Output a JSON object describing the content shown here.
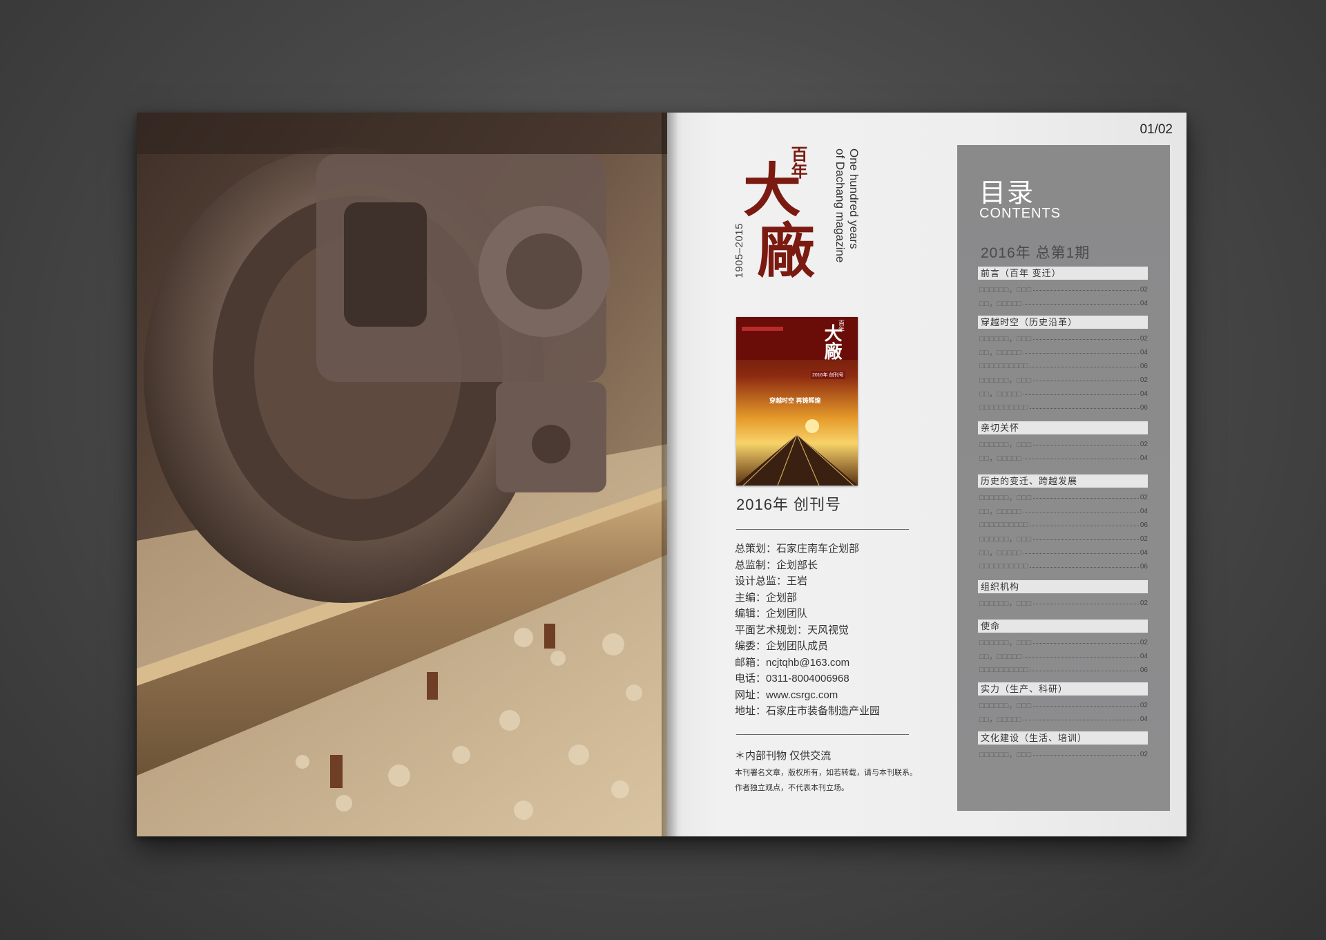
{
  "colors": {
    "logo_red": "#7a1a10",
    "panel_gray": "#8c8c8d",
    "section_bar": "#e6e6e6"
  },
  "page_number": "01/02",
  "masthead": {
    "logo_small": "百年",
    "logo_large_1": "大",
    "logo_large_2": "廠",
    "english_line1": "One hundred years",
    "english_line2": "of Dachang magazine",
    "years": "1905–2015"
  },
  "cover": {
    "logo_small": "百年",
    "logo_large": "大廠",
    "edition_tag": "2016年 创刊号",
    "headline": "穿越时空  再铸辉煌"
  },
  "edition": "2016年 创刊号",
  "credits": [
    {
      "label": "总策划",
      "value": "石家庄南车企划部"
    },
    {
      "label": "总监制",
      "value": "企划部长"
    },
    {
      "label": "设计总监",
      "value": "王岩"
    },
    {
      "label": "主编",
      "value": "企划部"
    },
    {
      "label": "编辑",
      "value": "企划团队"
    },
    {
      "label": "平面艺术规划",
      "value": "天风视觉"
    },
    {
      "label": "编委",
      "value": "企划团队成员"
    },
    {
      "label": "邮箱",
      "value": "ncjtqhb@163.com"
    },
    {
      "label": "电话",
      "value": "0311-8004006968"
    },
    {
      "label": "网址",
      "value": "www.csrgc.com"
    },
    {
      "label": "地址",
      "value": "石家庄市装备制造产业园"
    }
  ],
  "notice": {
    "line1": "＊内部刊物  仅供交流",
    "line2": "本刊署名文章，版权所有，如若转载，请与本刊联系。",
    "line3": "作者独立观点，不代表本刊立场。"
  },
  "contents": {
    "title": "目录",
    "subtitle": "CONTENTS",
    "issue": "2016年 总第1期",
    "sections": [
      {
        "heading": "前言（百年 变迁）",
        "entries": [
          {
            "text": "□□□□□□，□□□",
            "page": "02"
          },
          {
            "text": "□□，□□□□□",
            "page": "04"
          }
        ]
      },
      {
        "heading": "穿越时空（历史沿革）",
        "entries": [
          {
            "text": "□□□□□□，□□□",
            "page": "02"
          },
          {
            "text": "□□，□□□□□",
            "page": "04"
          },
          {
            "text": "□□□□□□□□□□",
            "page": "06"
          },
          {
            "text": "□□□□□□，□□□",
            "page": "02"
          },
          {
            "text": "□□，□□□□□",
            "page": "04"
          },
          {
            "text": "□□□□□□□□□□",
            "page": "06"
          }
        ]
      },
      {
        "heading": "亲切关怀",
        "entries": [
          {
            "text": "□□□□□□，□□□",
            "page": "02"
          },
          {
            "text": "□□，□□□□□",
            "page": "04"
          }
        ]
      },
      {
        "heading": "历史的变迁、跨越发展",
        "entries": [
          {
            "text": "□□□□□□，□□□",
            "page": "02"
          },
          {
            "text": "□□，□□□□□",
            "page": "04"
          },
          {
            "text": "□□□□□□□□□□",
            "page": "06"
          },
          {
            "text": "□□□□□□，□□□",
            "page": "02"
          },
          {
            "text": "□□，□□□□□",
            "page": "04"
          },
          {
            "text": "□□□□□□□□□□",
            "page": "06"
          }
        ]
      },
      {
        "heading": "组织机构",
        "entries": [
          {
            "text": "□□□□□□，□□□",
            "page": "02"
          }
        ]
      },
      {
        "heading": "使命",
        "entries": [
          {
            "text": "□□□□□□，□□□",
            "page": "02"
          },
          {
            "text": "□□，□□□□□",
            "page": "04"
          },
          {
            "text": "□□□□□□□□□□",
            "page": "06"
          }
        ]
      },
      {
        "heading": "实力（生产、科研）",
        "entries": [
          {
            "text": "□□□□□□，□□□",
            "page": "02"
          },
          {
            "text": "□□，□□□□□",
            "page": "04"
          }
        ]
      },
      {
        "heading": "文化建设（生活、培训）",
        "entries": [
          {
            "text": "□□□□□□，□□□",
            "page": "02"
          }
        ]
      }
    ]
  }
}
